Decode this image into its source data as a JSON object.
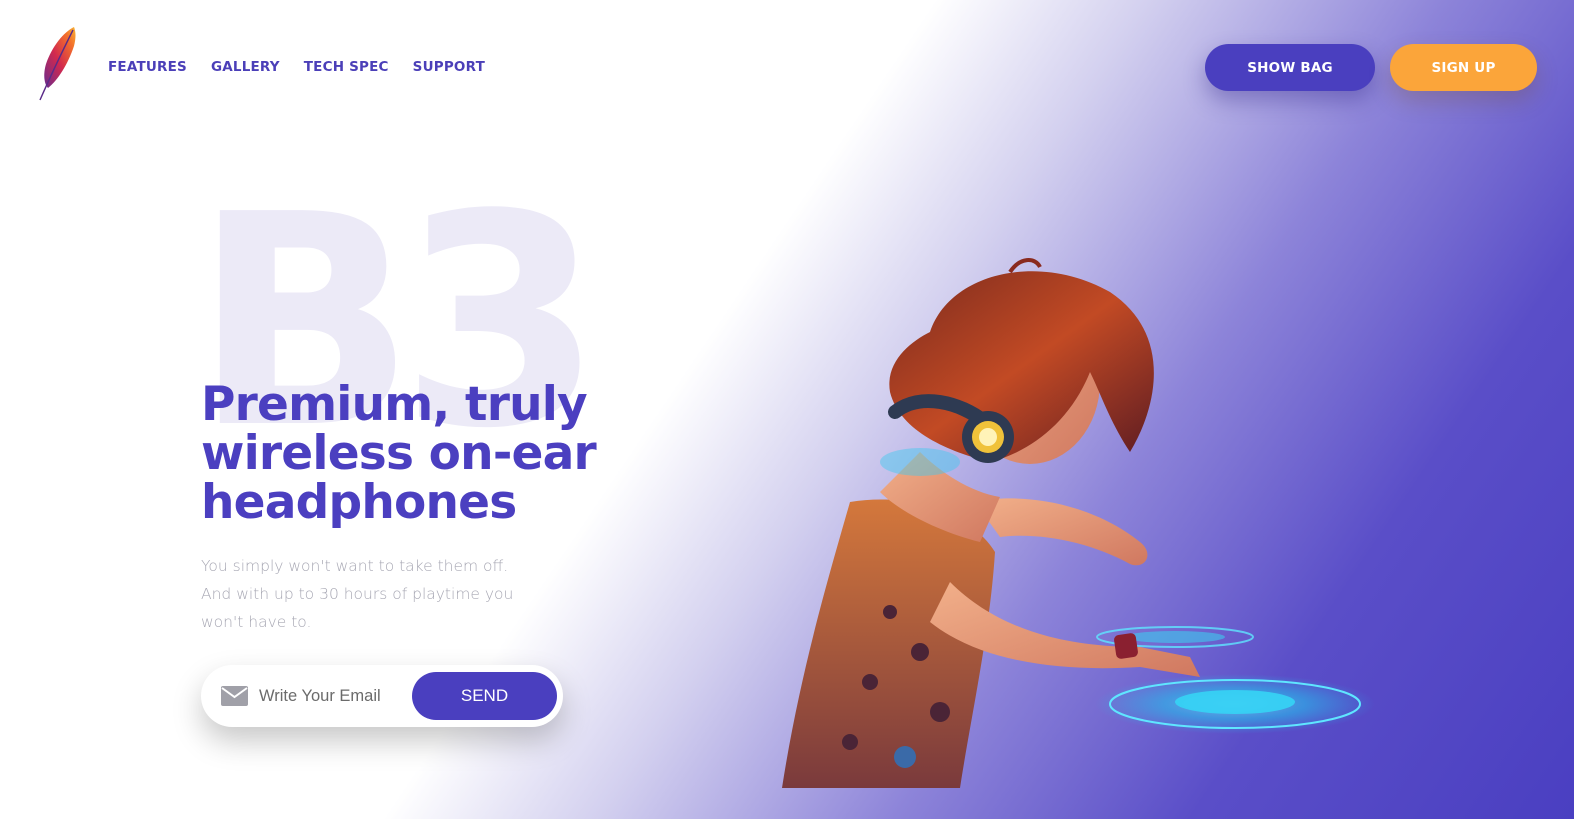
{
  "nav": {
    "items": [
      {
        "label": "FEATURES"
      },
      {
        "label": "GALLERY"
      },
      {
        "label": "TECH SPEC"
      },
      {
        "label": "SUPPORT"
      }
    ]
  },
  "header": {
    "show_bag_label": "SHOW BAG",
    "sign_up_label": "SIGN UP"
  },
  "hero": {
    "watermark": "B3",
    "headline": "Premium, truly wireless on-ear headphones",
    "subtext": "You simply won't want to take them off. And with up to 30 hours of playtime you won't have to.",
    "email_placeholder": "Write Your Email",
    "send_label": "SEND"
  },
  "colors": {
    "accent": "#4a3fbf",
    "sign_up": "#fba53a",
    "text_muted": "#a8a8b4"
  },
  "icons": {
    "logo": "feather-logo-icon",
    "email": "envelope-icon"
  }
}
